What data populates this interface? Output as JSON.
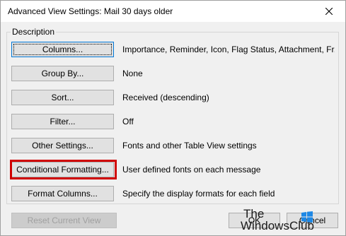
{
  "window": {
    "title": "Advanced View Settings: Mail 30 days older",
    "close_icon": "close-icon"
  },
  "group": {
    "legend": "Description"
  },
  "rows": [
    {
      "label": "Columns...",
      "description": "Importance, Reminder, Icon, Flag Status, Attachment, Fr..."
    },
    {
      "label": "Group By...",
      "description": "None"
    },
    {
      "label": "Sort...",
      "description": "Received (descending)"
    },
    {
      "label": "Filter...",
      "description": "Off"
    },
    {
      "label": "Other Settings...",
      "description": "Fonts and other Table View settings"
    },
    {
      "label": "Conditional Formatting...",
      "description": "User defined fonts on each message"
    },
    {
      "label": "Format Columns...",
      "description": "Specify the display formats for each field"
    }
  ],
  "footer": {
    "reset_label": "Reset Current View",
    "ok_label": "OK",
    "cancel_label": "Cancel"
  },
  "watermark": {
    "line1": "The",
    "line2": "WindowsClub"
  },
  "colors": {
    "highlight": "#d00000",
    "focus": "#0078d7",
    "watermark_logo": "#1e88e5"
  }
}
